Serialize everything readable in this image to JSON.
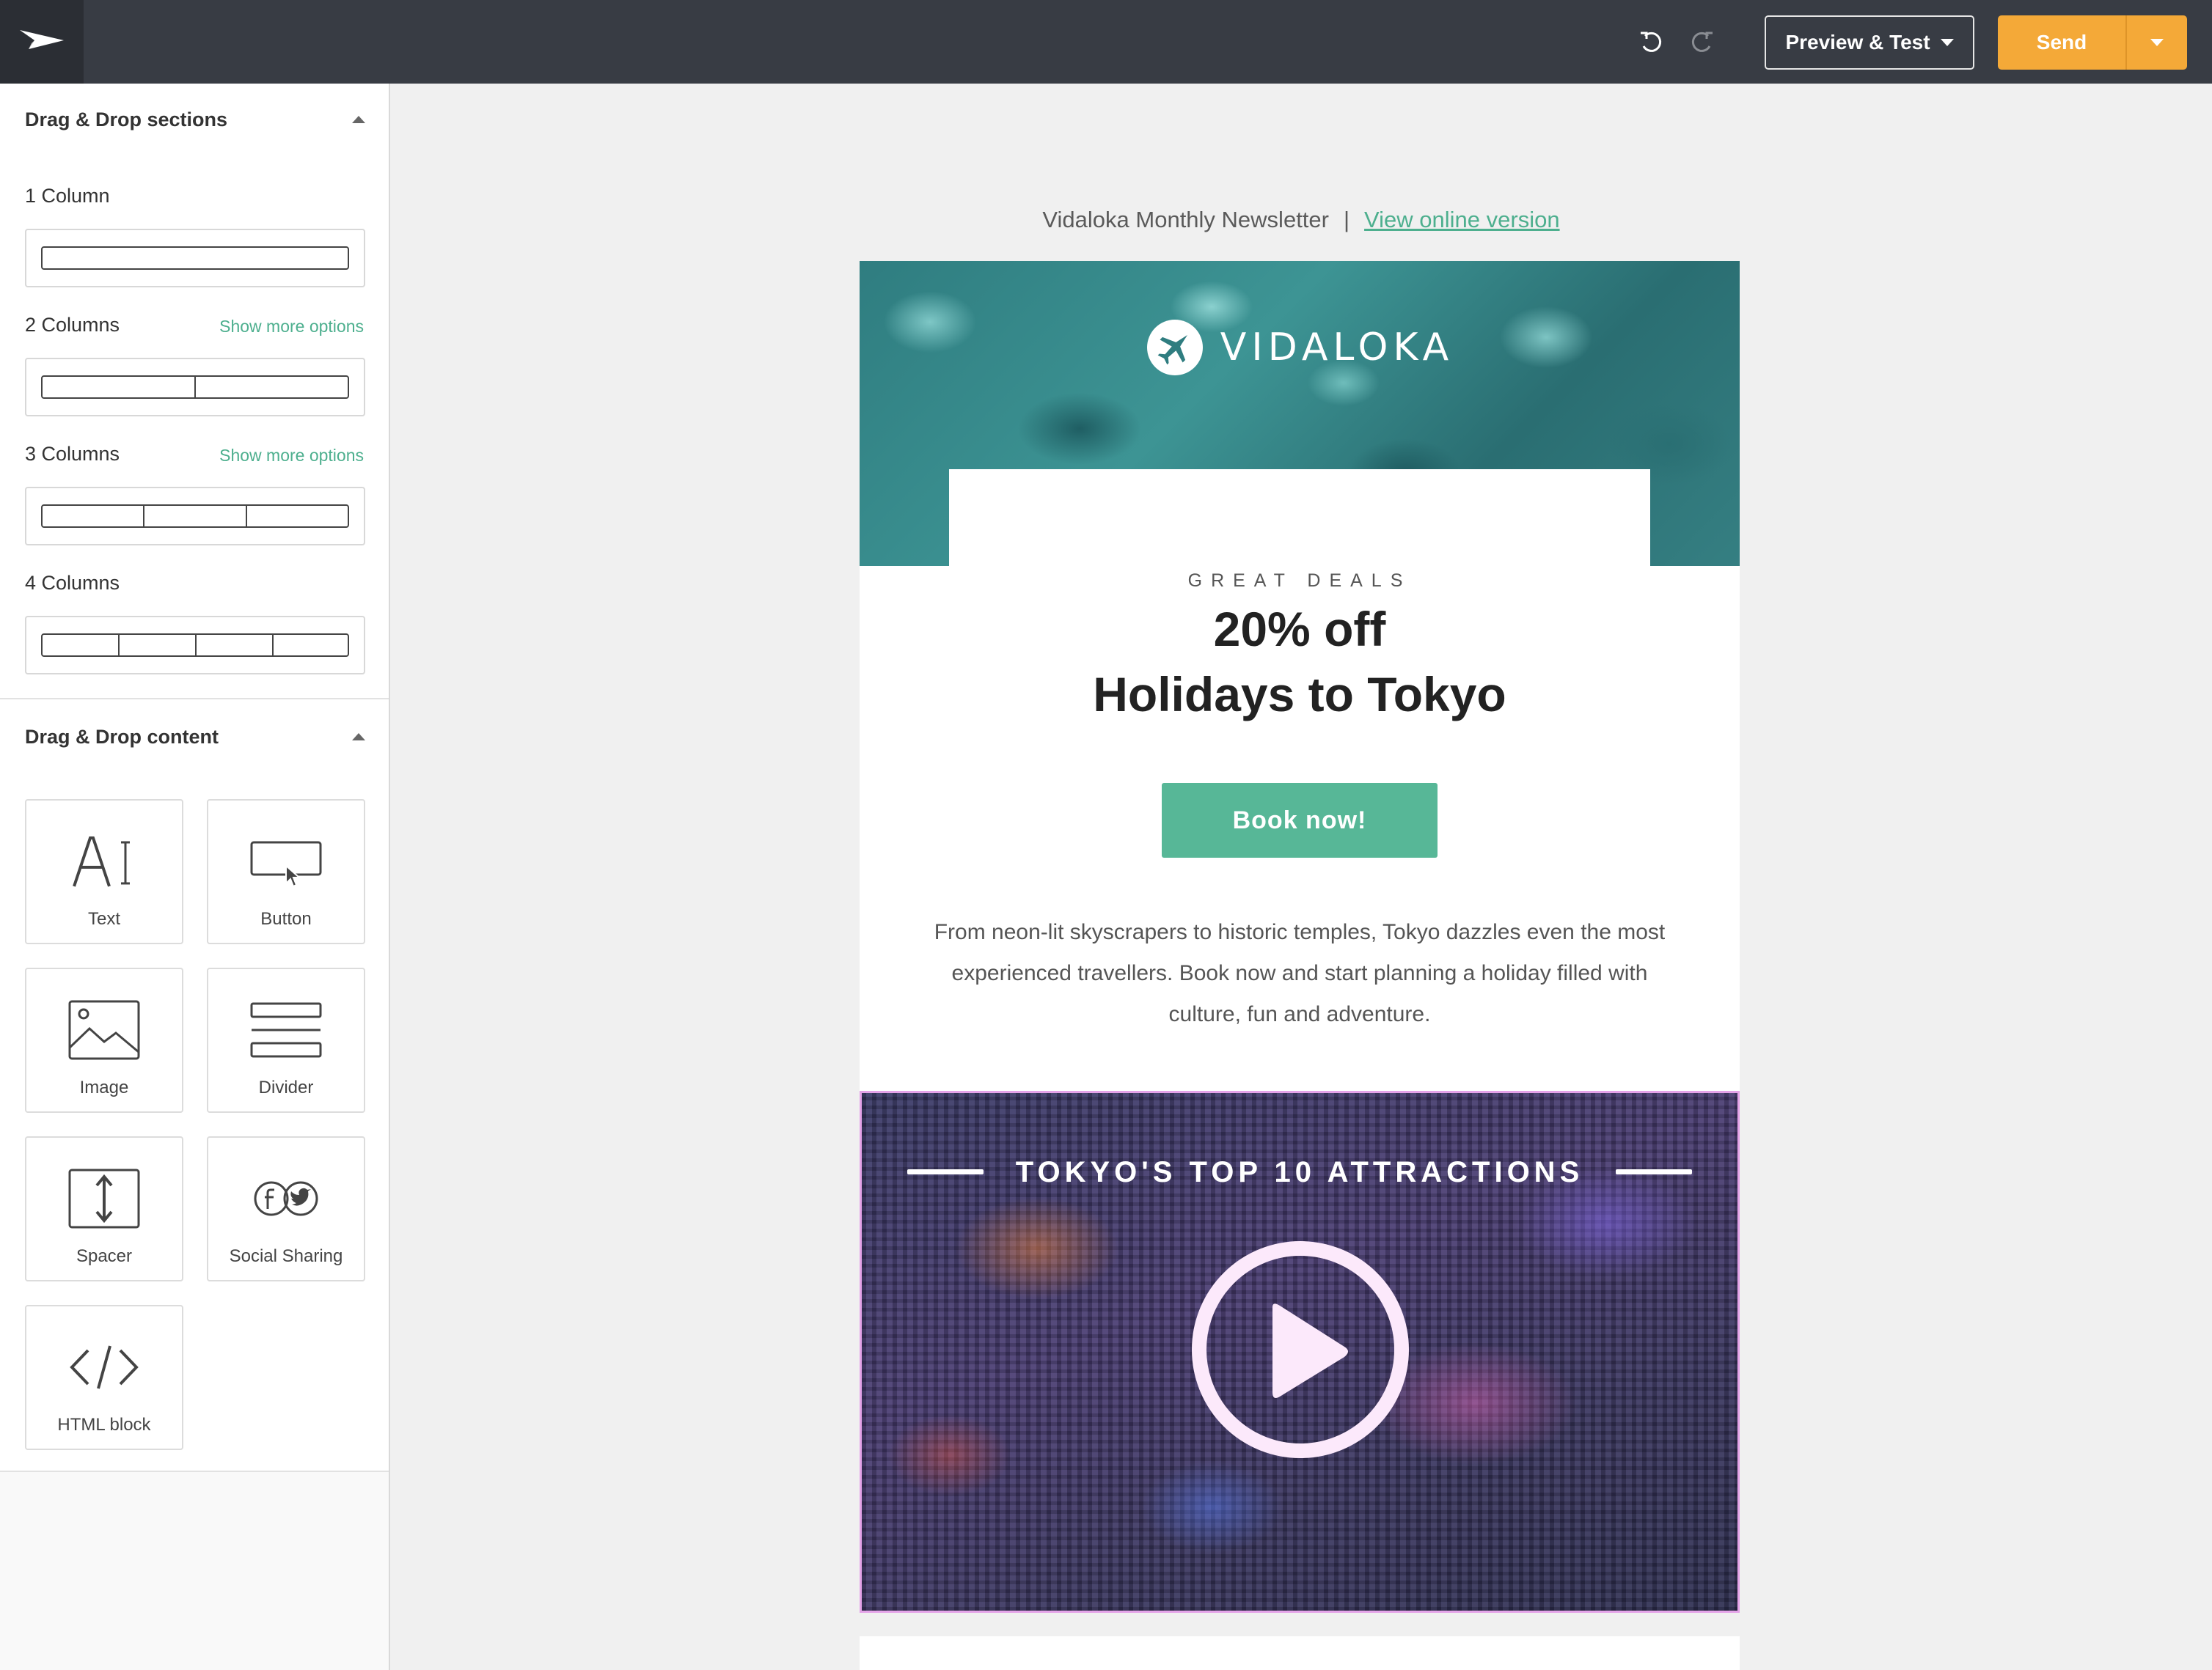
{
  "topbar": {
    "logo_icon": "paper-plane-icon",
    "undo_icon": "undo-icon",
    "redo_icon": "redo-icon",
    "preview_label": "Preview & Test",
    "send_label": "Send"
  },
  "sidebar": {
    "sections_title": "Drag & Drop sections",
    "columns": [
      {
        "label": "1 Column",
        "more": ""
      },
      {
        "label": "2 Columns",
        "more": "Show more options"
      },
      {
        "label": "3 Columns",
        "more": "Show more options"
      },
      {
        "label": "4 Columns",
        "more": ""
      }
    ],
    "content_title": "Drag & Drop content",
    "tiles": [
      {
        "label": "Text",
        "icon": "text-icon"
      },
      {
        "label": "Button",
        "icon": "button-icon"
      },
      {
        "label": "Image",
        "icon": "image-icon"
      },
      {
        "label": "Divider",
        "icon": "divider-icon"
      },
      {
        "label": "Spacer",
        "icon": "spacer-icon"
      },
      {
        "label": "Social Sharing",
        "icon": "social-sharing-icon"
      },
      {
        "label": "HTML block",
        "icon": "code-icon"
      }
    ]
  },
  "email": {
    "preheader": "Vidaloka Monthly Newsletter",
    "separator": "|",
    "online_link": "View online version",
    "brand": "VIDALOKA",
    "deals": "GREAT DEALS",
    "headline_1": "20% off",
    "headline_2": "Holidays to Tokyo",
    "cta": "Book now!",
    "body": "From neon-lit skyscrapers to historic temples, Tokyo dazzles even the most experienced travellers. Book now and start planning a holiday filled with culture, fun and adventure.",
    "video_title": "TOKYO'S TOP 10 ATTRACTIONS"
  },
  "colors": {
    "topbar": "#383c44",
    "send": "#f4a938",
    "accent_green": "#57b797",
    "link_green": "#4daf8e",
    "selected_outline": "#e4a3e8"
  }
}
